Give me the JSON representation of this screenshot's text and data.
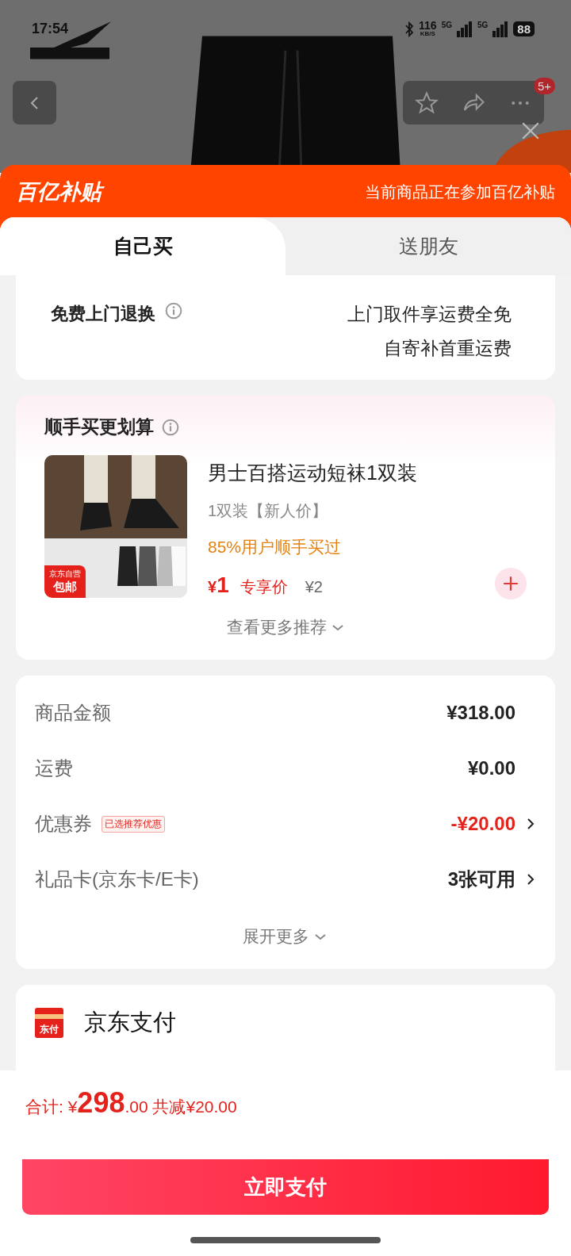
{
  "status_bar": {
    "time": "17:54",
    "speed": "116",
    "speed_unit": "KB/S",
    "networks": [
      "5G",
      "5G"
    ],
    "battery": "88"
  },
  "nav": {
    "badge": "5+"
  },
  "banner": {
    "logo": "百亿补贴",
    "note": "当前商品正在参加百亿补贴"
  },
  "tabs": [
    {
      "label": "自己买",
      "selected": true
    },
    {
      "label": "送朋友",
      "selected": false
    }
  ],
  "returns": {
    "title": "免费上门退换",
    "lines": [
      "上门取件享运费全免",
      "自寄补首重运费"
    ]
  },
  "addon": {
    "title": "顺手买更划算",
    "product": {
      "badge": [
        "京东自营",
        "包邮"
      ],
      "name": "男士百搭运动短袜1双装",
      "spec": "1双装【新人价】",
      "social": "85%用户顺手买过",
      "currency": "¥",
      "price": "1",
      "price_tag": "专享价",
      "original_price": "¥2"
    },
    "more": "查看更多推荐"
  },
  "fees": [
    {
      "kind": "plain",
      "label": "商品金额",
      "value": "¥318.00",
      "highlight": false
    },
    {
      "kind": "plain",
      "label": "运费",
      "value": "¥0.00",
      "highlight": false
    },
    {
      "kind": "link",
      "label": "优惠券",
      "tag": "已选推荐优惠",
      "value": "-¥20.00",
      "highlight": true
    },
    {
      "kind": "link",
      "label": "礼品卡(京东卡/E卡)",
      "value": "3张可用",
      "highlight": false
    }
  ],
  "fees_more": "展开更多",
  "payment": {
    "icon_text": "东付",
    "name": "京东支付"
  },
  "total": {
    "label": "合计:",
    "currency": "¥",
    "integer": "298",
    "decimals": ".00",
    "saved": "共减¥20.00"
  },
  "pay_button": "立即支付"
}
